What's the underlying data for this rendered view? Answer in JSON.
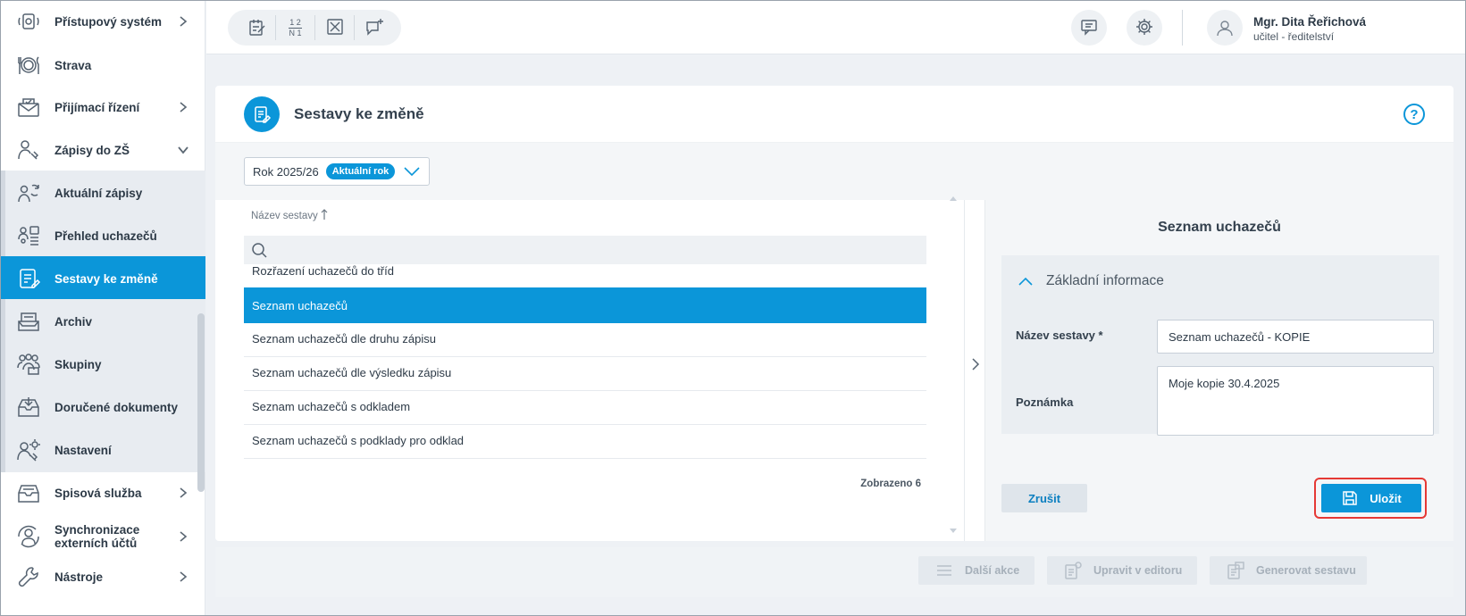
{
  "sidebar": {
    "items": [
      {
        "label": "Přístupový systém",
        "icon": "access-system-icon"
      },
      {
        "label": "Strava",
        "icon": "plate-icon"
      },
      {
        "label": "Přijímací řízení",
        "icon": "admission-icon"
      },
      {
        "label": "Zápisy do ZŠ",
        "icon": "enrollment-icon"
      },
      {
        "label": "Aktuální zápisy",
        "icon": "users-refresh-icon"
      },
      {
        "label": "Přehled uchazečů",
        "icon": "applicants-list-icon"
      },
      {
        "label": "Sestavy ke změně",
        "icon": "report-edit-icon"
      },
      {
        "label": "Archiv",
        "icon": "archive-icon"
      },
      {
        "label": "Skupiny",
        "icon": "groups-icon"
      },
      {
        "label": "Doručené dokumenty",
        "icon": "inbox-icon"
      },
      {
        "label": "Nastavení",
        "icon": "user-gear-icon"
      },
      {
        "label": "Spisová služba",
        "icon": "filing-icon"
      },
      {
        "label": "Synchronizace externích účtů",
        "icon": "sync-icon"
      },
      {
        "label": "Nástroje",
        "icon": "wrench-icon"
      }
    ]
  },
  "topbar": {
    "user_name": "Mgr. Dita Řeřichová",
    "user_role": "učitel - ředitelství",
    "fraction_top": "1 2",
    "fraction_bottom": "N 1"
  },
  "page": {
    "title": "Sestavy ke změně",
    "help": "?"
  },
  "year_filter": {
    "value": "Rok 2025/26",
    "badge": "Aktuální rok"
  },
  "list": {
    "column_header": "Název sestavy",
    "search_placeholder": "",
    "rows": [
      "Rozřazení uchazečů do tříd",
      "Seznam uchazečů",
      "Seznam uchazečů dle druhu zápisu",
      "Seznam uchazečů dle výsledku zápisu",
      "Seznam uchazečů s odkladem",
      "Seznam uchazečů s podklady pro odklad"
    ],
    "selected_index": 1,
    "count_text": "Zobrazeno 6"
  },
  "detail": {
    "title": "Seznam uchazečů",
    "section_title": "Základní informace",
    "name_label": "Název sestavy *",
    "name_value": "Seznam uchazečů - KOPIE",
    "note_label": "Poznámka",
    "note_value": "Moje kopie 30.4.2025",
    "cancel_label": "Zrušit",
    "save_label": "Uložit"
  },
  "actions": {
    "more": "Další akce",
    "edit": "Upravit v editoru",
    "generate": "Generovat sestavu"
  },
  "colors": {
    "accent": "#0b96d9",
    "highlight": "#e53935"
  }
}
